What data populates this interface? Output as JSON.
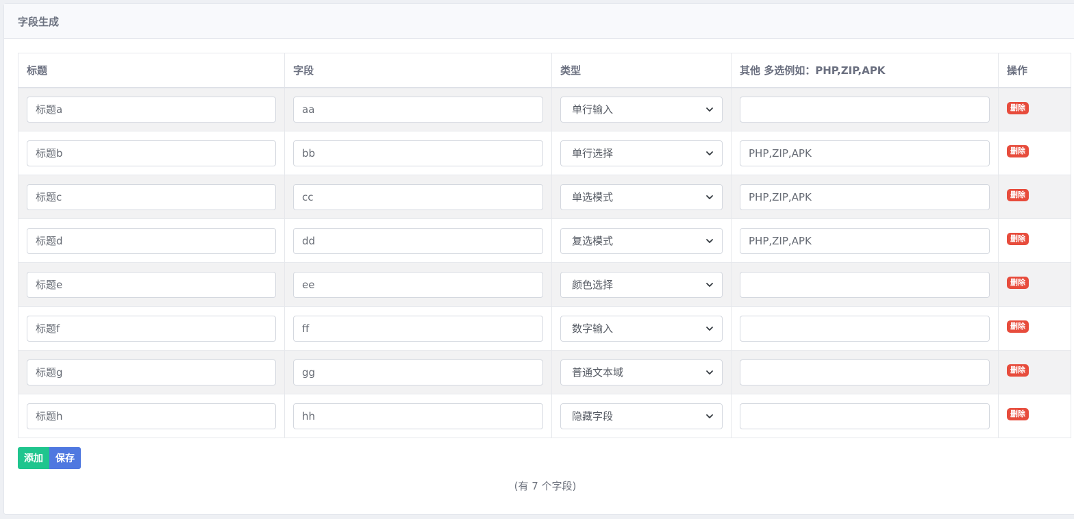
{
  "panel": {
    "title": "字段生成"
  },
  "table": {
    "headers": [
      "标题",
      "字段",
      "类型",
      "其他 多选例如：PHP,ZIP,APK",
      "操作"
    ],
    "rows": [
      {
        "title": "标题a",
        "field": "aa",
        "type": "单行输入",
        "other": ""
      },
      {
        "title": "标题b",
        "field": "bb",
        "type": "单行选择",
        "other": "PHP,ZIP,APK"
      },
      {
        "title": "标题c",
        "field": "cc",
        "type": "单选模式",
        "other": "PHP,ZIP,APK"
      },
      {
        "title": "标题d",
        "field": "dd",
        "type": "复选模式",
        "other": "PHP,ZIP,APK"
      },
      {
        "title": "标题e",
        "field": "ee",
        "type": "颜色选择",
        "other": ""
      },
      {
        "title": "标题f",
        "field": "ff",
        "type": "数字输入",
        "other": ""
      },
      {
        "title": "标题g",
        "field": "gg",
        "type": "普通文本域",
        "other": ""
      },
      {
        "title": "标题h",
        "field": "hh",
        "type": "隐藏字段",
        "other": ""
      }
    ],
    "delete_label": "删除"
  },
  "actions": {
    "add_label": "添加",
    "save_label": "保存"
  },
  "footer": {
    "count_text": "(有 7 个字段)"
  },
  "colors": {
    "delete": "#e74c3c",
    "add": "#1fc58e",
    "save": "#4f78e0"
  },
  "icons": {
    "select_arrow": "chevron-down-icon"
  }
}
